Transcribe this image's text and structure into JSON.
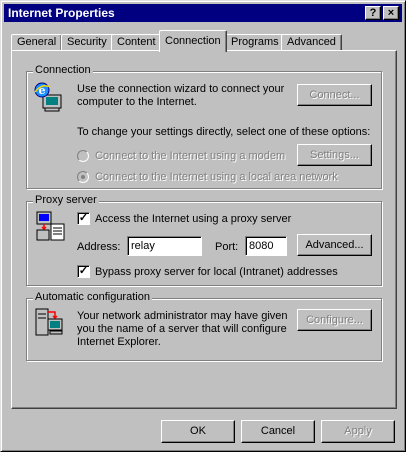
{
  "window": {
    "title": "Internet Properties",
    "help_glyph": "?",
    "close_glyph": "×"
  },
  "tabs": [
    {
      "label": "General"
    },
    {
      "label": "Security"
    },
    {
      "label": "Content"
    },
    {
      "label": "Connection",
      "active": true
    },
    {
      "label": "Programs"
    },
    {
      "label": "Advanced"
    }
  ],
  "connection": {
    "legend": "Connection",
    "wizard_text_1": "Use the connection wizard to connect your",
    "wizard_text_2": "computer to the Internet.",
    "connect_button": "Connect...",
    "change_text": "To change your settings directly, select one of these options:",
    "radio_modem": "Connect to the Internet using a modem",
    "settings_button": "Settings...",
    "radio_lan": "Connect to the Internet using a local area network"
  },
  "proxy": {
    "legend": "Proxy server",
    "access_checkbox": "Access the Internet using a proxy server",
    "address_label": "Address:",
    "address_value": "relay",
    "port_label": "Port:",
    "port_value": "8080",
    "advanced_button": "Advanced...",
    "bypass_checkbox": "Bypass proxy server for local (Intranet) addresses",
    "check_glyph": "✓"
  },
  "auto": {
    "legend": "Automatic configuration",
    "text_1": "Your network administrator may have given",
    "text_2": "you the name of a server that will configure",
    "text_3": "Internet Explorer.",
    "configure_button": "Configure..."
  },
  "footer": {
    "ok": "OK",
    "cancel": "Cancel",
    "apply": "Apply"
  }
}
